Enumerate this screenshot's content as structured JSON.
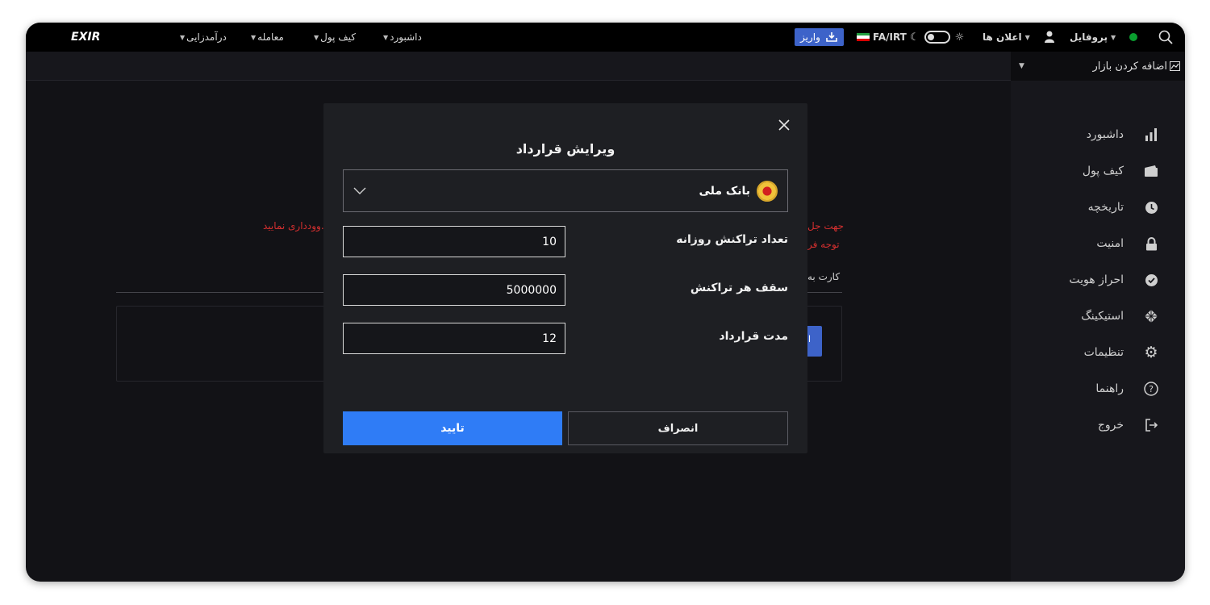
{
  "topbar": {
    "logo": "EXIR",
    "nav": [
      "درآمدزایی",
      "معامله",
      "کیف پول",
      "داشبورد"
    ],
    "deposit_label": "واریز",
    "currency_label": "FA/IRT",
    "announcements_label": "اعلان ها",
    "profile_label": "پروفایل",
    "status_color": "#0a9e2f"
  },
  "sidebar": {
    "add_market": "اضافه کردن بازار",
    "items": [
      {
        "label": "داشبورد",
        "icon": "bar-chart-icon"
      },
      {
        "label": "کیف پول",
        "icon": "wallet-icon"
      },
      {
        "label": "تاریخچه",
        "icon": "clock-icon"
      },
      {
        "label": "امنیت",
        "icon": "lock-icon"
      },
      {
        "label": "احراز هویت",
        "icon": "verified-check-icon"
      },
      {
        "label": "استیکینگ",
        "icon": "staking-icon"
      },
      {
        "label": "تنظیمات",
        "icon": "gear-icon"
      },
      {
        "label": "راهنما",
        "icon": "help-icon"
      },
      {
        "label": "خروج",
        "icon": "logout-icon"
      }
    ]
  },
  "background": {
    "red_line_1_start": "جهت جل",
    "red_line_1_end": "وودداری نمایید.",
    "red_line_2": "توجه فر",
    "card_label": "کارت به",
    "button_fragment": "ا"
  },
  "modal": {
    "title": "ویرایش قرارداد",
    "bank": "بانک ملی",
    "fields": [
      {
        "label": "تعداد تراکنش روزانه",
        "value": "10"
      },
      {
        "label": "سقف هر تراکنش",
        "value": "5000000"
      },
      {
        "label": "مدت قرارداد",
        "value": "12"
      }
    ],
    "cancel_label": "انصراف",
    "confirm_label": "تایید",
    "accent_color": "#2f7cf6"
  }
}
